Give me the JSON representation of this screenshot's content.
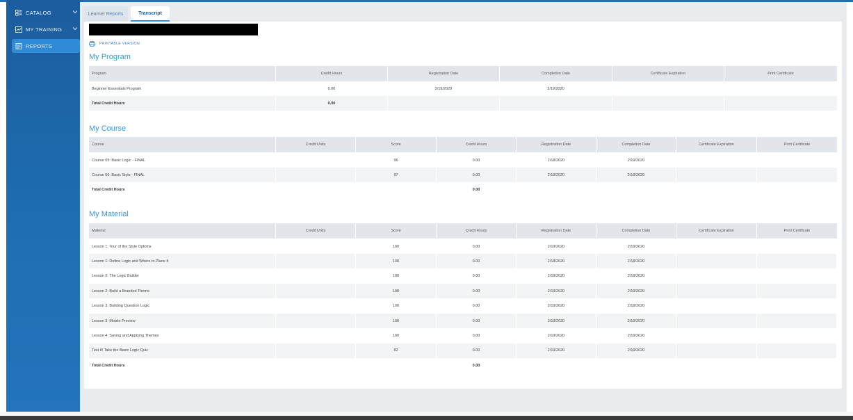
{
  "sidebar": {
    "items": [
      {
        "label": "CATALOG",
        "icon": "catalog-icon",
        "chevron": true
      },
      {
        "label": "MY TRAINING",
        "icon": "training-icon",
        "chevron": true
      },
      {
        "label": "REPORTS",
        "icon": "reports-icon",
        "active": true
      }
    ]
  },
  "tabs": {
    "learner_reports": "Learner Reports",
    "transcript": "Transcript"
  },
  "printable_version": "PRINTABLE VERSION",
  "program": {
    "title": "My Program",
    "headers": [
      "Program",
      "Credit Hours",
      "Registration Date",
      "Completion Date",
      "Certificate Expiration",
      "Print Certificate"
    ],
    "rows": [
      [
        "Beginner Essentials Program",
        "0.00",
        "2/19/2020",
        "2/19/2020",
        "",
        ""
      ]
    ],
    "total_label": "Total Credit Hours",
    "total_value": "0.00"
  },
  "course": {
    "title": "My Course",
    "headers": [
      "Course",
      "Credit Units",
      "Score",
      "Credit Hours",
      "Registration Date",
      "Completion Date",
      "Certificate Expiration",
      "Print Certificate"
    ],
    "rows": [
      [
        "Course 05: Basic Logic - FINAL",
        "",
        "96",
        "0.00",
        "2/18/2020",
        "2/19/2020",
        "",
        ""
      ],
      [
        "Course 06: Basic Style - FINAL",
        "",
        "97",
        "0.00",
        "2/19/2020",
        "2/19/2020",
        "",
        ""
      ]
    ],
    "total_label": "Total Credit Hours",
    "total_value": "0.00"
  },
  "material": {
    "title": "My Material",
    "headers": [
      "Material",
      "Credit Units",
      "Score",
      "Credit Hours",
      "Registration Date",
      "Completion Date",
      "Certificate Expiration",
      "Print Certificate"
    ],
    "rows": [
      [
        "Lesson 1: Tour of the Style Options",
        "",
        "100",
        "0.00",
        "2/19/2020",
        "2/19/2020",
        "",
        ""
      ],
      [
        "Lesson 1: Define Logic and Where to Place It",
        "",
        "100",
        "0.00",
        "2/18/2020",
        "2/18/2020",
        "",
        ""
      ],
      [
        "Lesson 2: The Logic Builder",
        "",
        "100",
        "0.00",
        "2/19/2020",
        "2/19/2020",
        "",
        ""
      ],
      [
        "Lesson 2: Build a Branded Theme",
        "",
        "100",
        "0.00",
        "2/19/2020",
        "2/19/2020",
        "",
        ""
      ],
      [
        "Lesson 3: Building Question Logic",
        "",
        "100",
        "0.00",
        "2/19/2020",
        "2/19/2020",
        "",
        ""
      ],
      [
        "Lesson 3: Mobile Preview",
        "",
        "100",
        "0.00",
        "2/19/2020",
        "2/19/2020",
        "",
        ""
      ],
      [
        "Lesson 4: Saving and Applying Themes",
        "",
        "100",
        "0.00",
        "2/19/2020",
        "2/19/2020",
        "",
        ""
      ],
      [
        "Test It! Take the Basic Logic Quiz",
        "",
        "82",
        "0.00",
        "2/19/2020",
        "2/19/2020",
        "",
        ""
      ]
    ],
    "total_label": "Total Credit Hours",
    "total_value": "0.00"
  },
  "colors": {
    "sidebar": "#1f6fb4",
    "accent": "#2e9be0",
    "header_bg": "#e2e5e9"
  }
}
